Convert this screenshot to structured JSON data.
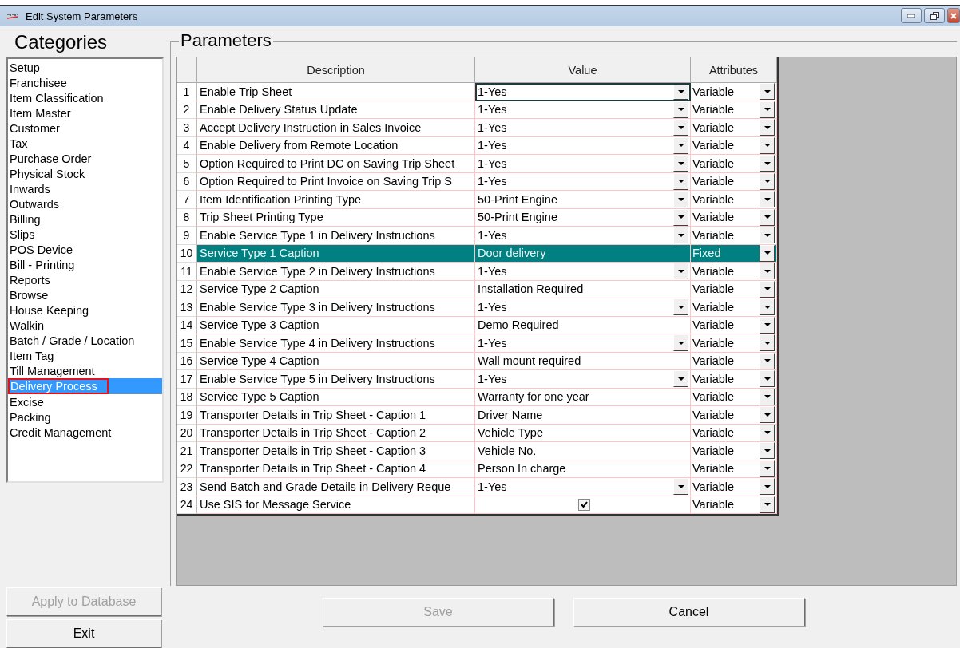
{
  "window": {
    "title": "Edit System Parameters"
  },
  "categories": {
    "title": "Categories",
    "items": [
      {
        "label": "Setup",
        "selected": false,
        "outlined": false
      },
      {
        "label": "Franchisee",
        "selected": false,
        "outlined": false
      },
      {
        "label": "Item Classification",
        "selected": false,
        "outlined": false
      },
      {
        "label": "Item Master",
        "selected": false,
        "outlined": false
      },
      {
        "label": "Customer",
        "selected": false,
        "outlined": false
      },
      {
        "label": "Tax",
        "selected": false,
        "outlined": false
      },
      {
        "label": "Purchase Order",
        "selected": false,
        "outlined": false
      },
      {
        "label": "Physical Stock",
        "selected": false,
        "outlined": false
      },
      {
        "label": "Inwards",
        "selected": false,
        "outlined": false
      },
      {
        "label": "Outwards",
        "selected": false,
        "outlined": false
      },
      {
        "label": "Billing",
        "selected": false,
        "outlined": false
      },
      {
        "label": "Slips",
        "selected": false,
        "outlined": false
      },
      {
        "label": "POS Device",
        "selected": false,
        "outlined": false
      },
      {
        "label": "Bill - Printing",
        "selected": false,
        "outlined": false
      },
      {
        "label": "Reports",
        "selected": false,
        "outlined": false
      },
      {
        "label": "Browse",
        "selected": false,
        "outlined": false
      },
      {
        "label": "House Keeping",
        "selected": false,
        "outlined": false
      },
      {
        "label": "Walkin",
        "selected": false,
        "outlined": false
      },
      {
        "label": "Batch / Grade / Location",
        "selected": false,
        "outlined": false
      },
      {
        "label": "Item Tag",
        "selected": false,
        "outlined": false
      },
      {
        "label": "Till Management",
        "selected": false,
        "outlined": false
      },
      {
        "label": "Delivery Process",
        "selected": true,
        "outlined": true
      },
      {
        "label": "Excise",
        "selected": false,
        "outlined": false
      },
      {
        "label": "Packing",
        "selected": false,
        "outlined": false
      },
      {
        "label": "Credit Management",
        "selected": false,
        "outlined": false
      }
    ]
  },
  "left_buttons": [
    {
      "label": "Apply to Database",
      "disabled": true
    },
    {
      "label": "Exit",
      "disabled": false
    }
  ],
  "parameters": {
    "title": "Parameters",
    "columns": [
      "Description",
      "Value",
      "Attributes"
    ],
    "rows": [
      {
        "number": "1",
        "description": "Enable Trip Sheet",
        "value": "1-Yes",
        "kind": "dropdown",
        "attribute": "Variable",
        "selected": false,
        "focused": true
      },
      {
        "number": "2",
        "description": "Enable Delivery Status Update",
        "value": "1-Yes",
        "kind": "dropdown",
        "attribute": "Variable",
        "selected": false,
        "focused": false
      },
      {
        "number": "3",
        "description": "Accept Delivery Instruction in Sales Invoice",
        "value": "1-Yes",
        "kind": "dropdown",
        "attribute": "Variable",
        "selected": false,
        "focused": false
      },
      {
        "number": "4",
        "description": "Enable Delivery from Remote Location",
        "value": "1-Yes",
        "kind": "dropdown",
        "attribute": "Variable",
        "selected": false,
        "focused": false
      },
      {
        "number": "5",
        "description": "Option Required to Print DC on Saving Trip Sheet",
        "value": "1-Yes",
        "kind": "dropdown",
        "attribute": "Variable",
        "selected": false,
        "focused": false
      },
      {
        "number": "6",
        "description": "Option Required to Print Invoice on Saving Trip S",
        "value": "1-Yes",
        "kind": "dropdown",
        "attribute": "Variable",
        "selected": false,
        "focused": false
      },
      {
        "number": "7",
        "description": "Item Identification Printing Type",
        "value": "50-Print Engine",
        "kind": "dropdown",
        "attribute": "Variable",
        "selected": false,
        "focused": false
      },
      {
        "number": "8",
        "description": "Trip Sheet Printing Type",
        "value": "50-Print Engine",
        "kind": "dropdown",
        "attribute": "Variable",
        "selected": false,
        "focused": false
      },
      {
        "number": "9",
        "description": "Enable Service Type 1 in Delivery Instructions",
        "value": "1-Yes",
        "kind": "dropdown",
        "attribute": "Variable",
        "selected": false,
        "focused": false
      },
      {
        "number": "10",
        "description": "Service Type 1 Caption",
        "value": "Door delivery",
        "kind": "text",
        "attribute": "Fixed",
        "selected": true,
        "focused": false
      },
      {
        "number": "11",
        "description": "Enable Service Type 2 in Delivery Instructions",
        "value": "1-Yes",
        "kind": "dropdown",
        "attribute": "Variable",
        "selected": false,
        "focused": false
      },
      {
        "number": "12",
        "description": "Service Type 2 Caption",
        "value": "Installation Required",
        "kind": "text",
        "attribute": "Variable",
        "selected": false,
        "focused": false
      },
      {
        "number": "13",
        "description": "Enable Service Type 3 in Delivery Instructions",
        "value": "1-Yes",
        "kind": "dropdown",
        "attribute": "Variable",
        "selected": false,
        "focused": false
      },
      {
        "number": "14",
        "description": "Service Type 3 Caption",
        "value": "Demo Required",
        "kind": "text",
        "attribute": "Variable",
        "selected": false,
        "focused": false
      },
      {
        "number": "15",
        "description": "Enable Service Type 4 in Delivery Instructions",
        "value": "1-Yes",
        "kind": "dropdown",
        "attribute": "Variable",
        "selected": false,
        "focused": false
      },
      {
        "number": "16",
        "description": "Service Type 4 Caption",
        "value": "Wall mount required",
        "kind": "text",
        "attribute": "Variable",
        "selected": false,
        "focused": false
      },
      {
        "number": "17",
        "description": "Enable Service Type 5 in Delivery Instructions",
        "value": "1-Yes",
        "kind": "dropdown",
        "attribute": "Variable",
        "selected": false,
        "focused": false
      },
      {
        "number": "18",
        "description": "Service Type 5 Caption",
        "value": "Warranty for one year",
        "kind": "text",
        "attribute": "Variable",
        "selected": false,
        "focused": false
      },
      {
        "number": "19",
        "description": "Transporter Details in Trip Sheet - Caption 1",
        "value": "Driver Name",
        "kind": "text",
        "attribute": "Variable",
        "selected": false,
        "focused": false
      },
      {
        "number": "20",
        "description": "Transporter Details in Trip Sheet - Caption 2",
        "value": "Vehicle Type",
        "kind": "text",
        "attribute": "Variable",
        "selected": false,
        "focused": false
      },
      {
        "number": "21",
        "description": "Transporter Details in Trip Sheet - Caption 3",
        "value": "Vehicle No.",
        "kind": "text",
        "attribute": "Variable",
        "selected": false,
        "focused": false
      },
      {
        "number": "22",
        "description": "Transporter Details in Trip Sheet - Caption 4",
        "value": "Person In charge",
        "kind": "text",
        "attribute": "Variable",
        "selected": false,
        "focused": false
      },
      {
        "number": "23",
        "description": "Send Batch and Grade Details in Delivery Reque",
        "value": "1-Yes",
        "kind": "dropdown",
        "attribute": "Variable",
        "selected": false,
        "focused": false
      },
      {
        "number": "24",
        "description": "Use SIS for Message Service",
        "checked": true,
        "kind": "checkbox",
        "attribute": "Variable",
        "selected": false,
        "focused": false
      }
    ]
  },
  "bottom_buttons": [
    {
      "label": "Save",
      "disabled": true
    },
    {
      "label": "Cancel",
      "disabled": false
    }
  ]
}
